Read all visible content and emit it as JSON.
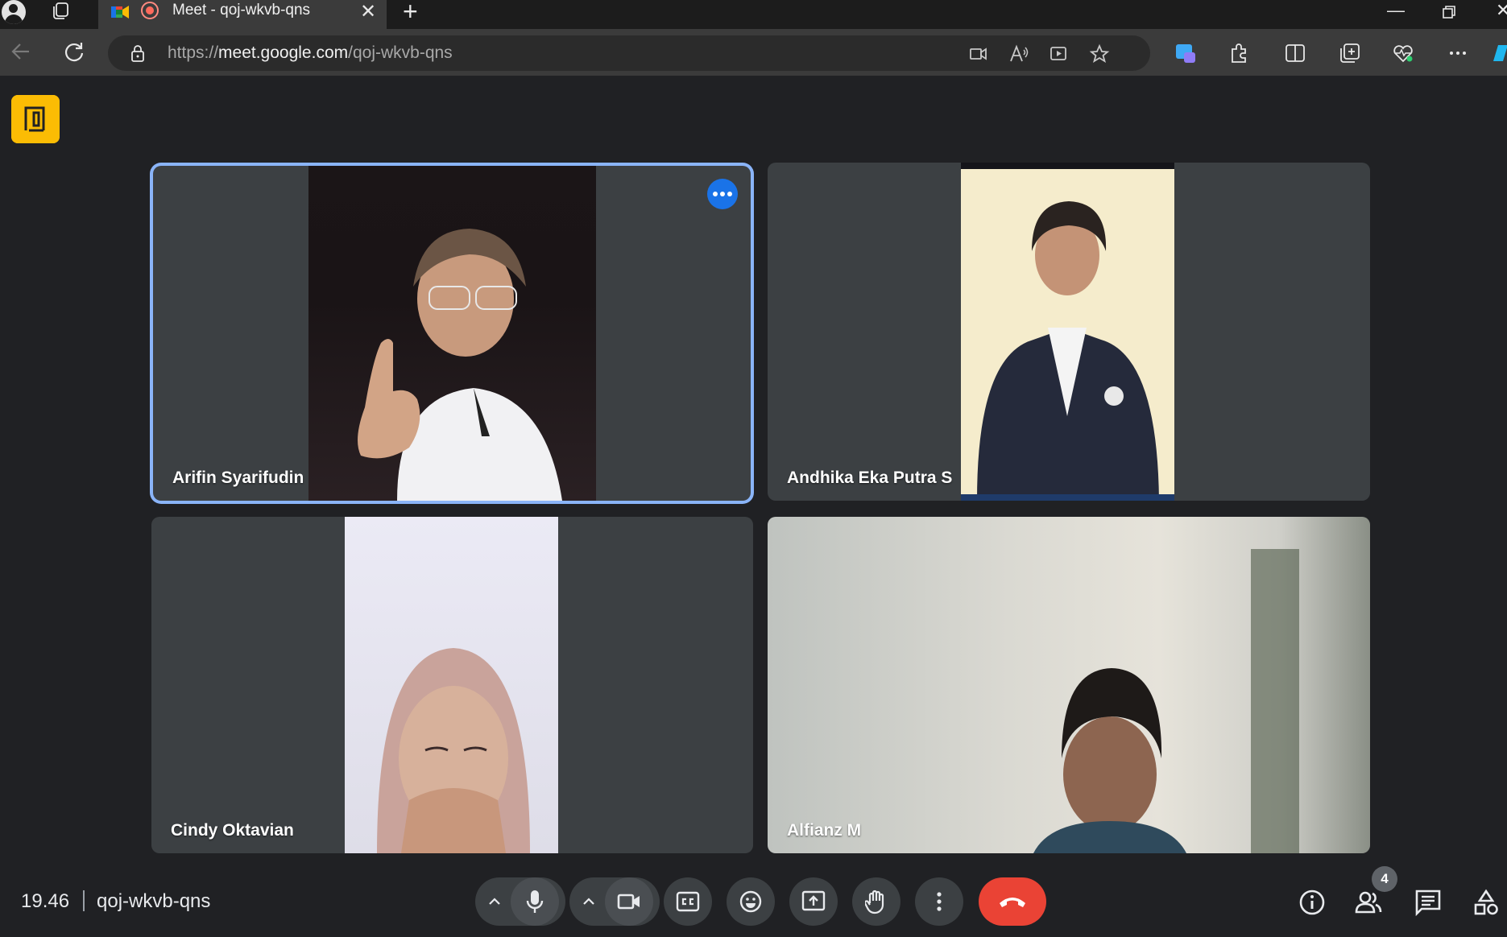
{
  "browser": {
    "tab": {
      "title": "Meet - qoj-wkvb-qns"
    },
    "url": {
      "prefix": "https://",
      "host": "meet.google.com",
      "path": "/qoj-wkvb-qns"
    }
  },
  "meeting": {
    "time": "19.46",
    "code": "qoj-wkvb-qns",
    "participant_count": "4",
    "participants": [
      {
        "name": "Arifin Syarifudin",
        "speaking": true
      },
      {
        "name": "Andhika Eka Putra S",
        "speaking": false
      },
      {
        "name": "Cindy Oktavian",
        "speaking": false
      },
      {
        "name": "Alfianz M",
        "speaking": false
      }
    ]
  },
  "icons": {
    "mic": "microphone-icon",
    "camera": "camera-icon",
    "captions": "captions-icon",
    "reactions": "emoji-icon",
    "present": "present-screen-icon",
    "raise_hand": "raise-hand-icon",
    "more": "more-vert-icon",
    "hangup": "hangup-icon",
    "info": "info-icon",
    "people": "people-icon",
    "chat": "chat-icon",
    "activities": "activities-icon"
  },
  "colors": {
    "accent": "#1a73e8",
    "active_border": "#8ab4f8",
    "hangup": "#ea4335",
    "host_badge": "#fbbc04",
    "tile_bg": "#3c4043",
    "page_bg": "#202124"
  }
}
